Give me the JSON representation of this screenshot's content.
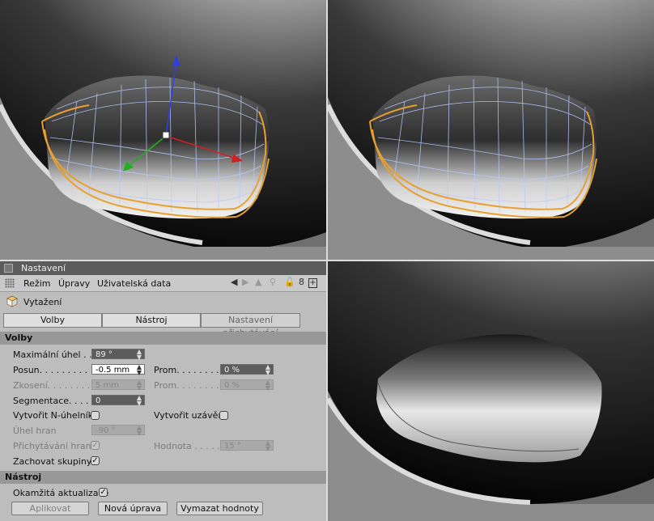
{
  "window": {
    "title": "Nastavení"
  },
  "menu": {
    "items": [
      "Režim",
      "Úpravy",
      "Uživatelská data"
    ]
  },
  "object": {
    "name": "Vytažení",
    "icon": "extrude-cube-icon"
  },
  "tabs": [
    "Volby",
    "Nástroj",
    "Nastavení přichytávání"
  ],
  "options_section": {
    "title": "Volby",
    "max_angle": {
      "label": "Maximální úhel . .",
      "value": "89 °"
    },
    "offset": {
      "label": "Posun. . . . . . . . .",
      "value": "-0.5 mm"
    },
    "offset_var": {
      "label": "Prom. . . . . . . . .",
      "value": "0 %"
    },
    "bevel": {
      "label": "Zkosení. . . . . . . .",
      "value": "5 mm"
    },
    "bevel_var": {
      "label": "Prom. . . . . . . . .",
      "value": "0 %"
    },
    "subdivision": {
      "label": "Segmentace. . . . .",
      "value": "0"
    },
    "create_ngons": {
      "label": "Vytvořit N-úhelníky",
      "checked": false
    },
    "create_caps": {
      "label": "Vytvořit uzávěry",
      "checked": false
    },
    "edge_angle": {
      "label": "Úhel hran",
      "value": "-90 °"
    },
    "edge_snapping": {
      "label": "Přichytávání hran",
      "checked": true
    },
    "snap_value": {
      "label": "Hodnota . . . . . .",
      "value": "15 °"
    },
    "preserve_groups": {
      "label": "Zachovat skupiny",
      "checked": true
    }
  },
  "tool_section": {
    "title": "Nástroj",
    "realtime_update": {
      "label": "Okamžitá aktualizace",
      "checked": true
    },
    "buttons": {
      "apply": "Aplikovat",
      "new_transform": "Nová úprava",
      "reset": "Vymazat hodnoty"
    }
  },
  "colors": {
    "selection_edge": "#e8a030",
    "wire": "#b8c8ff",
    "panel_bg": "#bdbdbd",
    "section_header": "#989898"
  }
}
